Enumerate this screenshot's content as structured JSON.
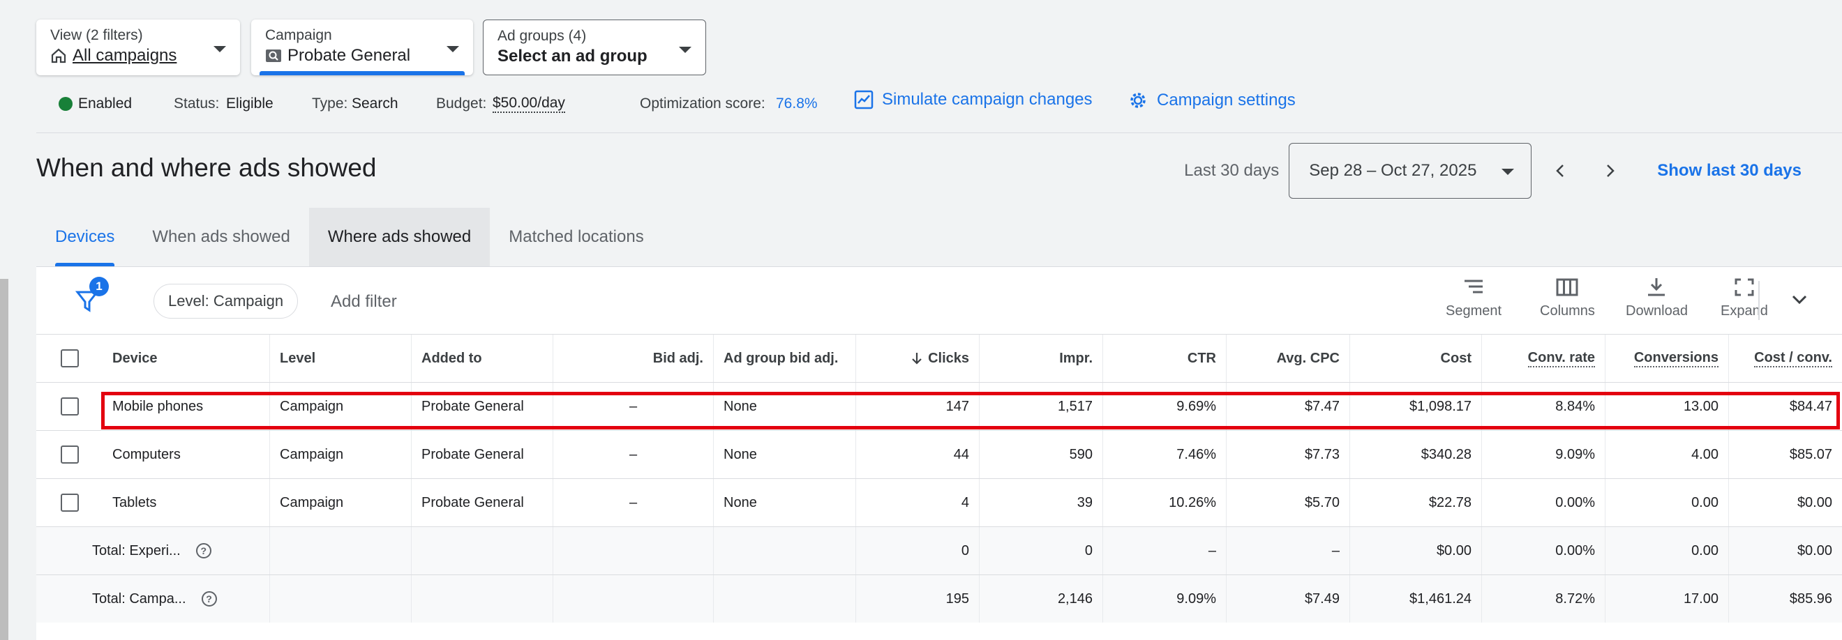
{
  "filters": {
    "view": {
      "label": "View (2 filters)",
      "value": "All campaigns"
    },
    "campaign": {
      "label": "Campaign",
      "value": "Probate General"
    },
    "ad_groups": {
      "label": "Ad groups (4)",
      "value": "Select an ad group"
    }
  },
  "status": {
    "enabled": "Enabled",
    "status_label": "Status:",
    "status_value": "Eligible",
    "type_label": "Type:",
    "type_value": "Search",
    "budget_label": "Budget:",
    "budget_value": "$50.00/day",
    "opt_label": "Optimization score:",
    "opt_value": "76.8%",
    "simulate": "Simulate campaign changes",
    "settings": "Campaign settings",
    "enabled_color": "#188038"
  },
  "page_title": "When and where ads showed",
  "date": {
    "preset": "Last 30 days",
    "range": "Sep 28 – Oct 27, 2025",
    "show_last": "Show last 30 days"
  },
  "tabs": [
    "Devices",
    "When ads showed",
    "Where ads showed",
    "Matched locations"
  ],
  "toolbar": {
    "filter_count": "1",
    "level_chip": "Level: Campaign",
    "add_filter": "Add filter",
    "segment": "Segment",
    "columns": "Columns",
    "download": "Download",
    "expand": "Expand"
  },
  "table": {
    "headers": [
      "Device",
      "Level",
      "Added to",
      "Bid adj.",
      "Ad group bid adj.",
      "Clicks",
      "Impr.",
      "CTR",
      "Avg. CPC",
      "Cost",
      "Conv. rate",
      "Conversions",
      "Cost / conv."
    ],
    "rows": [
      [
        "Mobile phones",
        "Campaign",
        "Probate General",
        "–",
        "None",
        "147",
        "1,517",
        "9.69%",
        "$7.47",
        "$1,098.17",
        "8.84%",
        "13.00",
        "$84.47"
      ],
      [
        "Computers",
        "Campaign",
        "Probate General",
        "–",
        "None",
        "44",
        "590",
        "7.46%",
        "$7.73",
        "$340.28",
        "9.09%",
        "4.00",
        "$85.07"
      ],
      [
        "Tablets",
        "Campaign",
        "Probate General",
        "–",
        "None",
        "4",
        "39",
        "10.26%",
        "$5.70",
        "$22.78",
        "0.00%",
        "0.00",
        "$0.00"
      ]
    ],
    "totals": [
      [
        "Total: Experi...",
        "",
        "",
        "",
        "",
        "0",
        "0",
        "–",
        "–",
        "$0.00",
        "0.00%",
        "0.00",
        "$0.00"
      ],
      [
        "Total: Campa...",
        "",
        "",
        "",
        "",
        "195",
        "2,146",
        "9.09%",
        "$7.49",
        "$1,461.24",
        "8.72%",
        "17.00",
        "$85.96"
      ]
    ],
    "highlight_color": "#e3000f"
  }
}
